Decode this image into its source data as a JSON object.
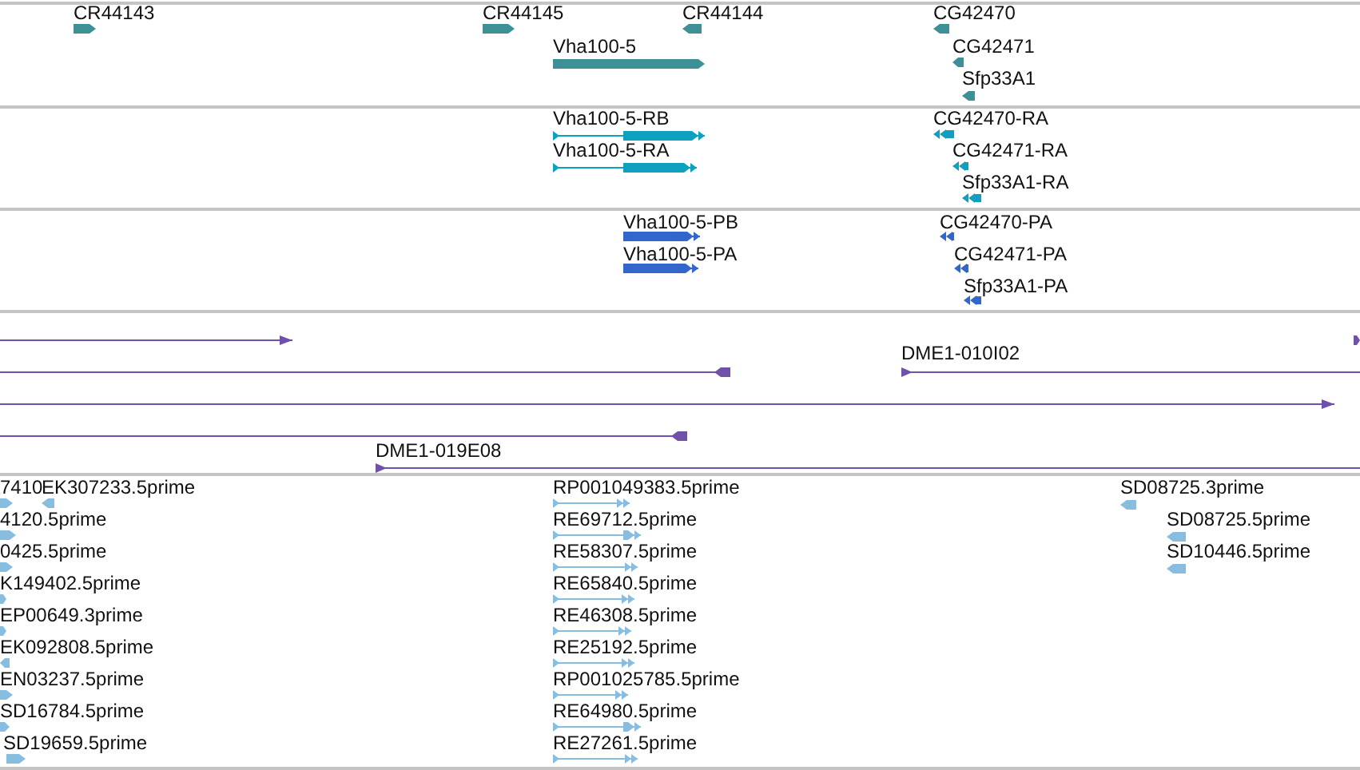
{
  "tracks": [
    {
      "color": "#3d9095",
      "features": [
        {
          "label": "CR44143",
          "kind": "block",
          "forward": true
        },
        {
          "label": "CR44145",
          "kind": "block",
          "forward": true
        },
        {
          "label": "CR44144",
          "kind": "block",
          "forward": false
        },
        {
          "label": "Vha100-5",
          "kind": "block",
          "forward": true
        },
        {
          "label": "CG42470",
          "kind": "block",
          "forward": false
        },
        {
          "label": "CG42471",
          "kind": "block",
          "forward": false
        },
        {
          "label": "Sfp33A1",
          "kind": "block",
          "forward": false
        }
      ]
    },
    {
      "color": "#0fa0c0",
      "features": [
        {
          "label": "Vha100-5-RB",
          "kind": "transcript",
          "forward": true
        },
        {
          "label": "Vha100-5-RA",
          "kind": "transcript",
          "forward": true
        },
        {
          "label": "CG42470-RA",
          "kind": "transcript",
          "forward": false
        },
        {
          "label": "CG42471-RA",
          "kind": "transcript",
          "forward": false
        },
        {
          "label": "Sfp33A1-RA",
          "kind": "transcript",
          "forward": false
        }
      ]
    },
    {
      "color": "#3366cc",
      "features": [
        {
          "label": "Vha100-5-PB",
          "kind": "transcript",
          "forward": true
        },
        {
          "label": "Vha100-5-PA",
          "kind": "transcript",
          "forward": true
        },
        {
          "label": "CG42470-PA",
          "kind": "transcript",
          "forward": false
        },
        {
          "label": "CG42471-PA",
          "kind": "transcript",
          "forward": false
        },
        {
          "label": "Sfp33A1-PA",
          "kind": "transcript",
          "forward": false
        }
      ]
    },
    {
      "color": "#7050a8",
      "features": [
        {
          "kind": "line",
          "forward": true
        },
        {
          "kind": "block",
          "forward": true
        },
        {
          "kind": "line",
          "forward": false
        },
        {
          "label": "DME1-010I02",
          "kind": "line",
          "forward": true
        },
        {
          "kind": "line",
          "forward": true
        },
        {
          "kind": "line",
          "forward": false
        },
        {
          "label": "DME1-019E08",
          "kind": "line",
          "forward": true
        }
      ]
    },
    {
      "color": "#88bde0",
      "features": [
        {
          "label": "7410",
          "kind": "block",
          "forward": true
        },
        {
          "label": "EK307233.5prime",
          "kind": "block",
          "forward": false
        },
        {
          "label": "4120.5prime",
          "kind": "block",
          "forward": true
        },
        {
          "label": "0425.5prime",
          "kind": "block",
          "forward": true
        },
        {
          "label": "K149402.5prime",
          "kind": "block",
          "forward": true
        },
        {
          "label": "EP00649.3prime",
          "kind": "block",
          "forward": true
        },
        {
          "label": "EK092808.5prime",
          "kind": "block",
          "forward": false
        },
        {
          "label": "EN03237.5prime",
          "kind": "block",
          "forward": true
        },
        {
          "label": "SD16784.5prime",
          "kind": "block",
          "forward": true
        },
        {
          "label": "SD19659.5prime",
          "kind": "block",
          "forward": true
        },
        {
          "label": "RP001049383.5prime",
          "kind": "transcript",
          "forward": true
        },
        {
          "label": "RE69712.5prime",
          "kind": "transcript",
          "forward": true
        },
        {
          "label": "RE58307.5prime",
          "kind": "transcript",
          "forward": true
        },
        {
          "label": "RE65840.5prime",
          "kind": "transcript",
          "forward": true
        },
        {
          "label": "RE46308.5prime",
          "kind": "transcript",
          "forward": true
        },
        {
          "label": "RE25192.5prime",
          "kind": "transcript",
          "forward": true
        },
        {
          "label": "RP001025785.5prime",
          "kind": "transcript",
          "forward": true
        },
        {
          "label": "RE64980.5prime",
          "kind": "transcript",
          "forward": true
        },
        {
          "label": "RE27261.5prime",
          "kind": "transcript",
          "forward": true
        },
        {
          "label": "SD08725.3prime",
          "kind": "block",
          "forward": false
        },
        {
          "label": "SD08725.5prime",
          "kind": "block",
          "forward": false
        },
        {
          "label": "SD10446.5prime",
          "kind": "block",
          "forward": false
        }
      ]
    }
  ]
}
